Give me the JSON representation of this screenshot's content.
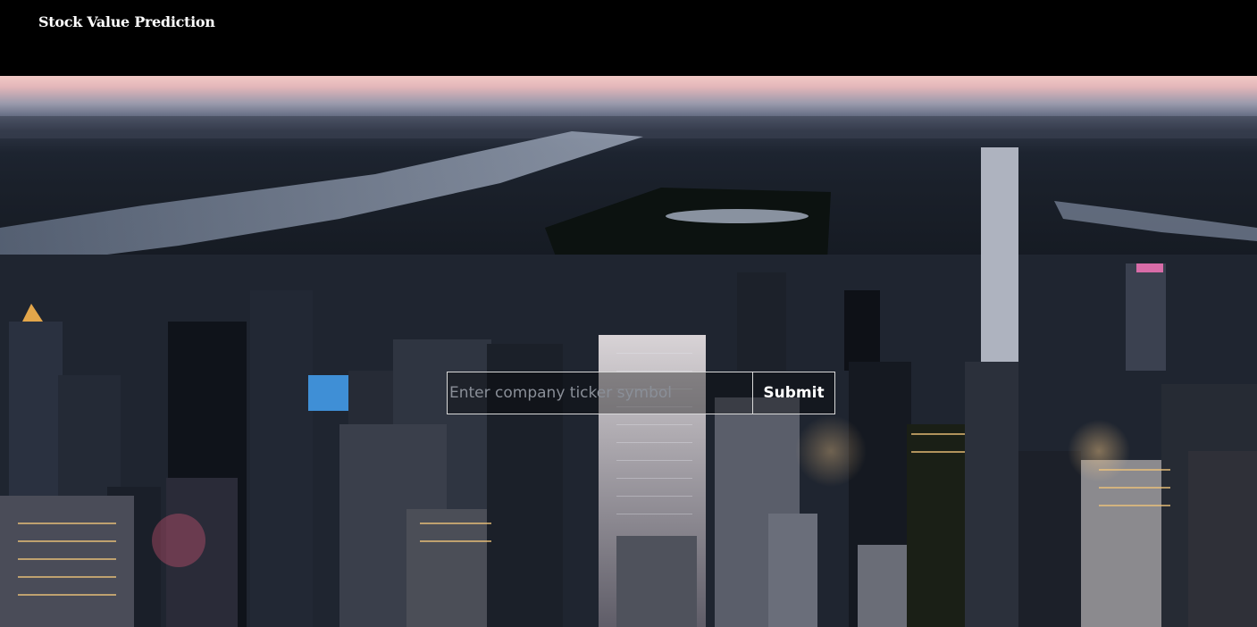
{
  "header": {
    "title": "Stock Value Prediction"
  },
  "search": {
    "placeholder": "Enter company ticker symbol",
    "value": "",
    "submit_label": "Submit"
  },
  "hero": {
    "image": "aerial-city-skyline-at-dusk"
  },
  "colors": {
    "header_bg": "#000000",
    "text": "#ffffff",
    "input_border": "#d9d9d9",
    "placeholder": "#8a8f98"
  }
}
